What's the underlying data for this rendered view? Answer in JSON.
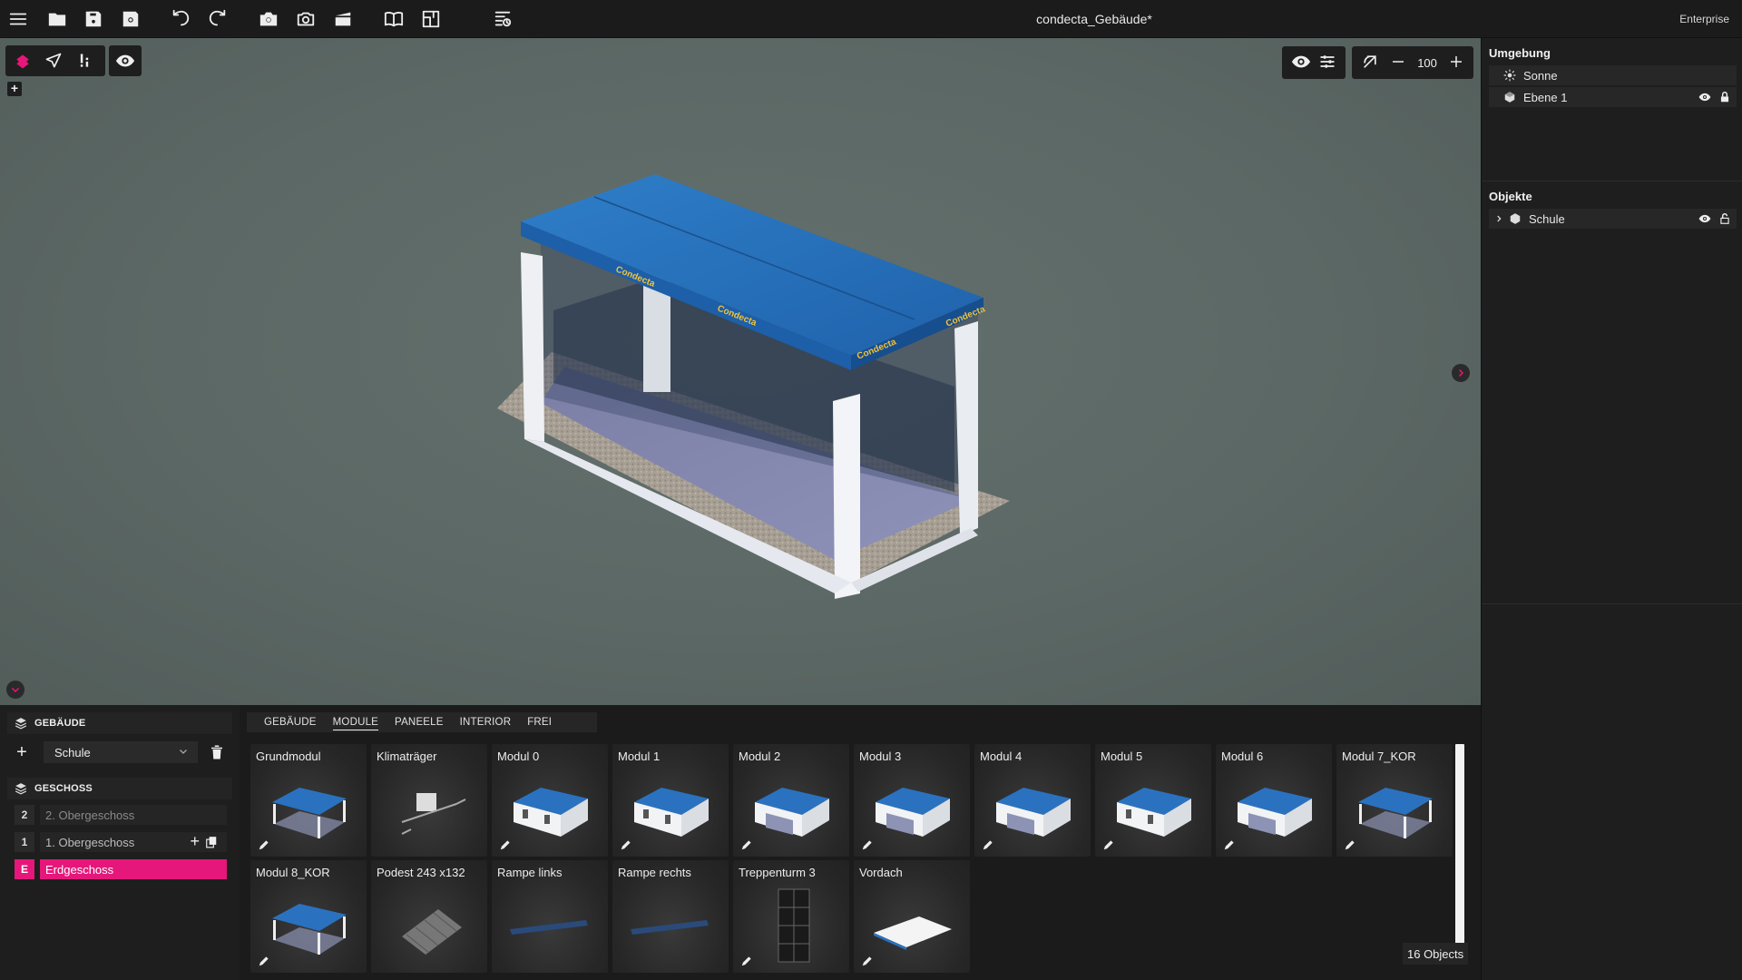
{
  "app": {
    "document_title": "condecta_Gebäude*",
    "edition": "Enterprise"
  },
  "viewport": {
    "zoom_value": "100",
    "accent_color": "#e5177a"
  },
  "right_panel": {
    "environment": {
      "title": "Umgebung",
      "items": [
        {
          "label": "Sonne",
          "icon": "sun-icon"
        },
        {
          "label": "Ebene 1",
          "icon": "cube-icon"
        }
      ]
    },
    "objects": {
      "title": "Objekte",
      "items": [
        {
          "label": "Schule",
          "icon": "cube-icon"
        }
      ]
    }
  },
  "building_panel": {
    "building_header": "GEBÄUDE",
    "selected_building": "Schule",
    "floor_header": "GESCHOSS",
    "floors": [
      {
        "number": "2",
        "name": "2. Obergeschoss"
      },
      {
        "number": "1",
        "name": "1. Obergeschoss"
      },
      {
        "number": "E",
        "name": "Erdgeschoss"
      }
    ]
  },
  "library": {
    "tabs": [
      "GEBÄUDE",
      "MODULE",
      "PANEELE",
      "INTERIOR",
      "FREI"
    ],
    "active_tab": "MODULE",
    "items": [
      {
        "label": "Grundmodul"
      },
      {
        "label": "Klimaträger"
      },
      {
        "label": "Modul 0"
      },
      {
        "label": "Modul 1"
      },
      {
        "label": "Modul 2"
      },
      {
        "label": "Modul 3"
      },
      {
        "label": "Modul 4"
      },
      {
        "label": "Modul 5"
      },
      {
        "label": "Modul 6"
      },
      {
        "label": "Modul 7_KOR"
      },
      {
        "label": "Modul 8_KOR"
      },
      {
        "label": "Podest 243 x132"
      },
      {
        "label": "Rampe links"
      },
      {
        "label": "Rampe rechts"
      },
      {
        "label": "Treppenturm 3"
      },
      {
        "label": "Vordach"
      }
    ],
    "count_label": "16 Objects"
  }
}
